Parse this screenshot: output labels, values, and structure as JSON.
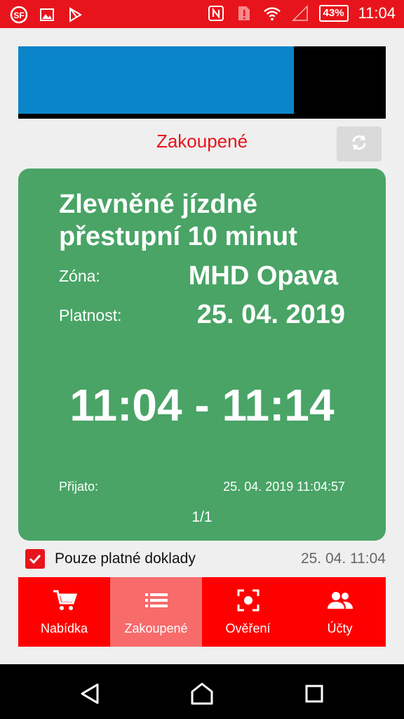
{
  "status_bar": {
    "battery": "43%",
    "time": "11:04"
  },
  "header": {
    "title": "Zakoupené"
  },
  "ticket": {
    "name": "Zlevněné jízdné přestupní 10 minut",
    "zone_label": "Zóna:",
    "zone_value": "MHD Opava",
    "validity_label": "Platnost:",
    "validity_value": "25. 04. 2019",
    "time_range": "11:04 - 11:14",
    "received_label": "Přijato:",
    "received_value": "25. 04. 2019 11:04:57",
    "pager": "1/1"
  },
  "filter": {
    "label": "Pouze platné doklady",
    "timestamp": "25. 04. 11:04",
    "checked": true
  },
  "nav": {
    "items": [
      {
        "label": "Nabídka",
        "icon": "cart-icon"
      },
      {
        "label": "Zakoupené",
        "icon": "list-icon",
        "active": true
      },
      {
        "label": "Ověření",
        "icon": "scan-icon"
      },
      {
        "label": "Účty",
        "icon": "people-icon"
      }
    ]
  },
  "colors": {
    "accent": "#e8141b",
    "ticket_bg": "#49a466",
    "banner_blue": "#0b85c9"
  }
}
